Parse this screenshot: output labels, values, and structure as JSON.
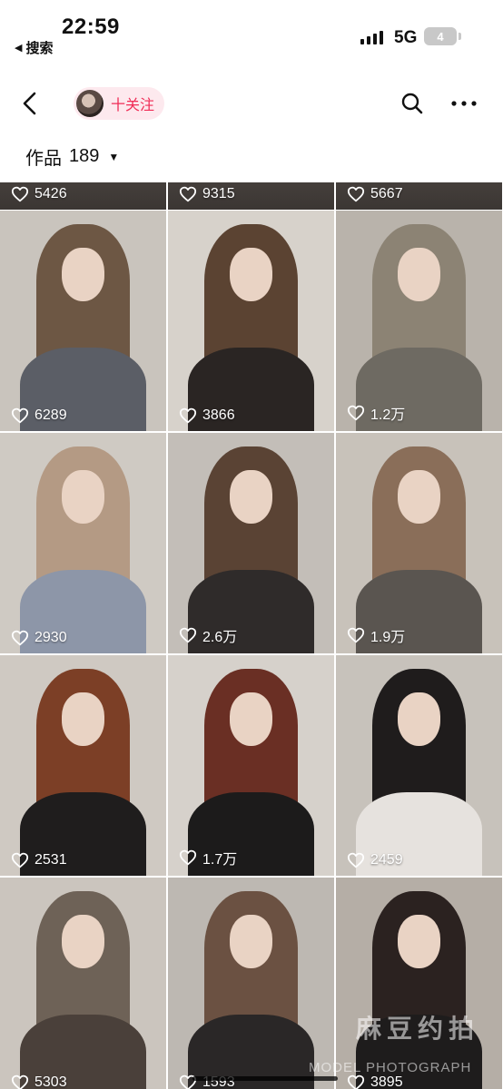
{
  "status_bar": {
    "time": "22:59",
    "back_app": "搜索",
    "network": "5G",
    "battery": "4"
  },
  "nav": {
    "follow_label": "十关注",
    "icons": [
      "back-icon",
      "search-icon",
      "more-icon"
    ]
  },
  "works": {
    "label": "作品",
    "count": "189"
  },
  "grid": {
    "top_row": [
      {
        "likes": "5426"
      },
      {
        "likes": "9315"
      },
      {
        "likes": "5667"
      }
    ],
    "tiles": [
      {
        "likes": "6289",
        "hair": "#6d5744",
        "bg": "#c9c4bd",
        "body": "#5b5e66"
      },
      {
        "likes": "3866",
        "hair": "#5b4332",
        "bg": "#d7d2cb",
        "body": "#2a2523"
      },
      {
        "likes": "1.2万",
        "hair": "#8c8374",
        "bg": "#b9b3ab",
        "body": "#6e6a62"
      },
      {
        "likes": "2930",
        "hair": "#b49a84",
        "bg": "#cfcac3",
        "body": "#8d96a8"
      },
      {
        "likes": "2.6万",
        "hair": "#5a4334",
        "bg": "#c3beb8",
        "body": "#2f2b2a"
      },
      {
        "likes": "1.9万",
        "hair": "#8a6e59",
        "bg": "#c8c2ba",
        "body": "#5a5550"
      },
      {
        "likes": "2531",
        "hair": "#7c3f26",
        "bg": "#cfc9c2",
        "body": "#1f1d1d"
      },
      {
        "likes": "1.7万",
        "hair": "#6a2f24",
        "bg": "#d6d1cb",
        "body": "#1c1b1b"
      },
      {
        "likes": "2459",
        "hair": "#1f1c1c",
        "bg": "#c7c2bb",
        "body": "#e6e2de"
      },
      {
        "likes": "5303",
        "hair": "#6e6257",
        "bg": "#cbc5be",
        "body": "#4a403a"
      },
      {
        "likes": "1593",
        "hair": "#6b5142",
        "bg": "#bdb8b2",
        "body": "#2a2727"
      },
      {
        "likes": "3895",
        "hair": "#2b2220",
        "bg": "#b5aea6",
        "body": "#1e1c1c"
      }
    ]
  },
  "watermark": {
    "cn": "麻豆约拍",
    "en": "MODEL PHOTOGRAPH"
  },
  "colors": {
    "accent": "#f02c56",
    "pill_bg": "#fde9ee"
  }
}
